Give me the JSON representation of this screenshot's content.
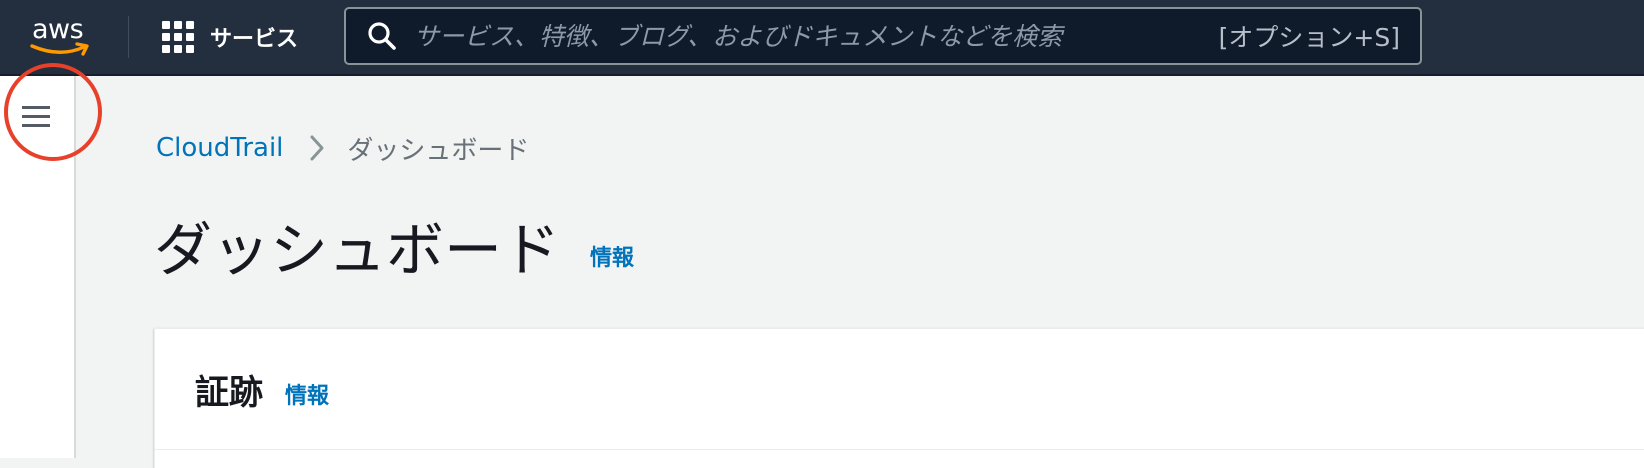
{
  "topbar": {
    "logo_text": "aws",
    "services_label": "サービス",
    "search": {
      "placeholder": "サービス、特徴、ブログ、およびドキュメントなどを検索",
      "shortcut": "[オプション+S]"
    }
  },
  "breadcrumb": {
    "items": [
      {
        "label": "CloudTrail"
      },
      {
        "label": "ダッシュボード"
      }
    ]
  },
  "page": {
    "title": "ダッシュボード",
    "info_label": "情報"
  },
  "panel": {
    "title": "証跡",
    "info_label": "情報"
  },
  "colors": {
    "topbar_bg": "#232f3e",
    "link": "#0073bb",
    "highlight": "#e8412b"
  },
  "icons": {
    "logo": "aws-logo",
    "services": "grid-icon",
    "search": "search-icon",
    "menu": "hamburger-menu-icon",
    "breadcrumb_separator": "chevron-right-icon"
  }
}
